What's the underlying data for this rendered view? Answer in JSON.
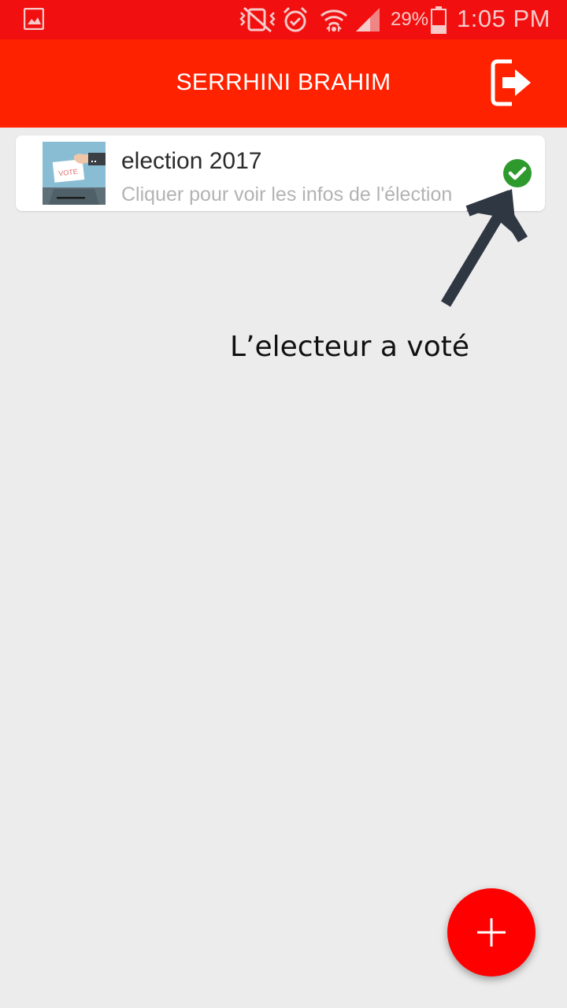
{
  "status_bar": {
    "battery_percent": "29%",
    "time": "1:05 PM",
    "icons": [
      "gallery-icon",
      "vibrate-mute-icon",
      "alarm-icon",
      "wifi-icon",
      "signal-icon",
      "battery-icon"
    ]
  },
  "app_bar": {
    "title": "SERRHINI BRAHIM",
    "logout_icon": "logout-icon"
  },
  "elections": [
    {
      "title": "election 2017",
      "subtitle": "Cliquer pour voir les infos de l'élection",
      "thumbnail_text": "VOTE",
      "status_icon": "check-circle-icon",
      "status_color": "#2e9a2e"
    }
  ],
  "annotation": {
    "text": "L’electeur a voté"
  },
  "fab": {
    "icon": "plus-icon",
    "color": "#ff0000"
  },
  "colors": {
    "status_bar": "#f10f0f",
    "app_bar": "#ff2200",
    "background": "#ececec"
  }
}
